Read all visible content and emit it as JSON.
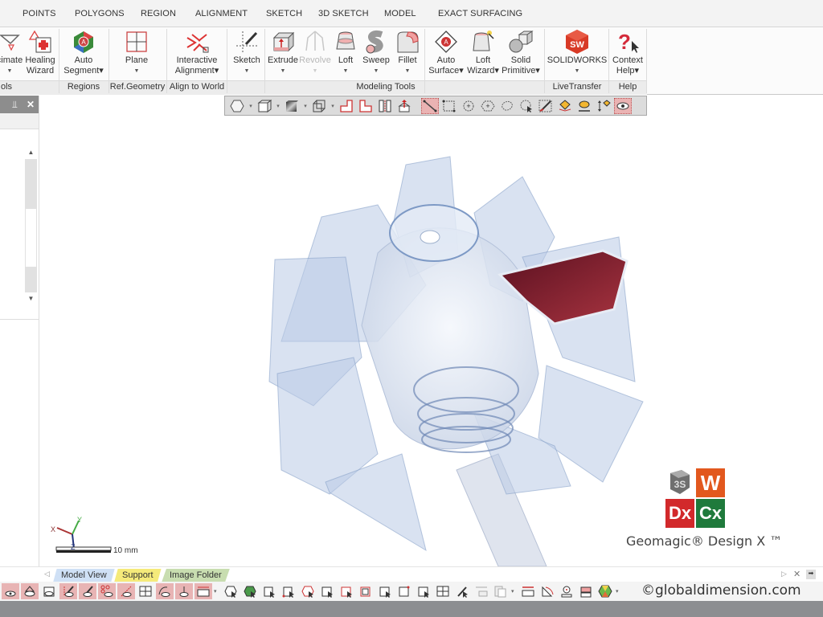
{
  "menu_tabs": [
    "POINTS",
    "POLYGONS",
    "REGION",
    "ALIGNMENT",
    "SKETCH",
    "3D SKETCH",
    "MODEL",
    "EXACT SURFACING"
  ],
  "ribbon": {
    "buttons": [
      {
        "label": "cimate",
        "label2": "",
        "has_arrow": true
      },
      {
        "label": "Healing",
        "label2": "Wizard",
        "has_arrow": false
      },
      {
        "label": "Auto",
        "label2": "Segment▾",
        "has_arrow": false
      },
      {
        "label": "Plane",
        "label2": "",
        "has_arrow": true
      },
      {
        "label": "Interactive",
        "label2": "Alignment▾",
        "has_arrow": false
      },
      {
        "label": "Sketch",
        "label2": "",
        "has_arrow": true
      },
      {
        "label": "Extrude",
        "label2": "",
        "has_arrow": true
      },
      {
        "label": "Revolve",
        "label2": "",
        "has_arrow": true,
        "disabled": true
      },
      {
        "label": "Loft",
        "label2": "",
        "has_arrow": true
      },
      {
        "label": "Sweep",
        "label2": "",
        "has_arrow": true
      },
      {
        "label": "Fillet",
        "label2": "",
        "has_arrow": true
      },
      {
        "label": "Auto",
        "label2": "Surface▾",
        "has_arrow": false
      },
      {
        "label": "Loft",
        "label2": "Wizard▾",
        "has_arrow": false
      },
      {
        "label": "Solid",
        "label2": "Primitive▾",
        "has_arrow": false
      },
      {
        "label": "SOLIDWORKS",
        "label2": "",
        "has_arrow": true
      },
      {
        "label": "Context",
        "label2": "Help▾",
        "has_arrow": false
      }
    ],
    "groups": [
      "ols",
      "Regions",
      "Ref.Geometry",
      "Align to World",
      "Modeling Tools",
      "LiveTransfer",
      "Help"
    ]
  },
  "view_toolbar": {
    "icons": [
      "render-mode-icon",
      "view-box-icon",
      "shading-icon",
      "wireframe-box-icon",
      "front-view-icon",
      "side-view-icon",
      "split-view-icon",
      "normal-up-icon",
      "line-select-icon",
      "rect-select-icon",
      "circle-select-icon",
      "polygon-select-icon",
      "lasso-select-icon",
      "freeform-select-icon",
      "paint-brush-icon",
      "fill-select-icon",
      "fill-visible-icon",
      "extend-select-icon",
      "visible-only-icon"
    ],
    "active": [
      "line-select-icon",
      "visible-only-icon"
    ]
  },
  "left_panel": {
    "pin": "⫫",
    "close": "✕"
  },
  "viewport": {
    "scale_label": "10 mm",
    "axes": {
      "x": "X",
      "y": "Y",
      "z": "Z"
    },
    "logo": {
      "w": "W",
      "dx": "Dx",
      "cx": "Cx",
      "product": "Geomagic® Design X ™"
    }
  },
  "bottom_tabs": [
    "Model View",
    "Support",
    "Image Folder"
  ],
  "bottom_tab_colors": [
    "#cfe0f5",
    "#f5ea7a",
    "#c8ddb0"
  ],
  "copyright": "©globaldimension.com",
  "colors": {
    "accent_red": "#d43a3a",
    "solidworks_red": "#d83a26",
    "ribbon_bg": "#fbfbfb"
  }
}
